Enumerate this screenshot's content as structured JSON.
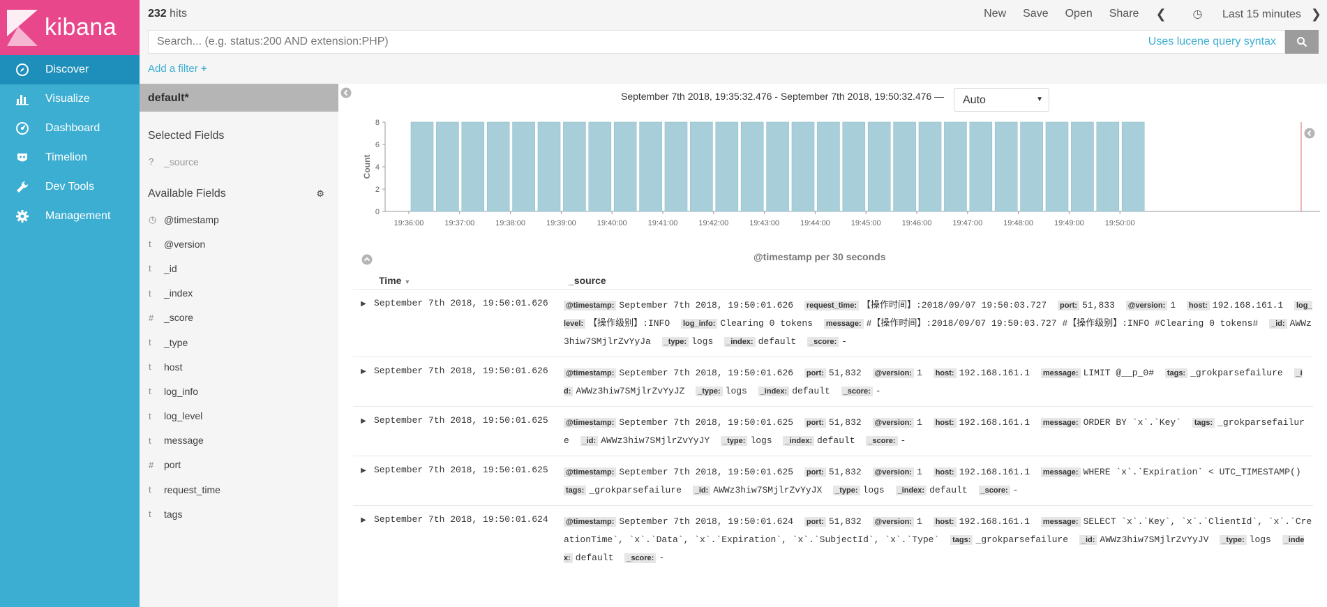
{
  "app": {
    "name": "kibana"
  },
  "nav": [
    {
      "label": "Discover",
      "icon": "compass-icon",
      "active": true
    },
    {
      "label": "Visualize",
      "icon": "bar-chart-icon",
      "active": false
    },
    {
      "label": "Dashboard",
      "icon": "dashboard-icon",
      "active": false
    },
    {
      "label": "Timelion",
      "icon": "timelion-icon",
      "active": false
    },
    {
      "label": "Dev Tools",
      "icon": "wrench-icon",
      "active": false
    },
    {
      "label": "Management",
      "icon": "gear-icon",
      "active": false
    }
  ],
  "topbar": {
    "hits_count": "232",
    "hits_label": "hits",
    "new": "New",
    "save": "Save",
    "open": "Open",
    "share": "Share",
    "time_range": "Last 15 minutes"
  },
  "search": {
    "placeholder": "Search... (e.g. status:200 AND extension:PHP)",
    "syntax_hint": "Uses lucene query syntax"
  },
  "filter": {
    "add_label": "Add a filter"
  },
  "side": {
    "index_pattern": "default*",
    "selected_title": "Selected Fields",
    "selected": [
      {
        "type": "?",
        "name": "_source"
      }
    ],
    "available_title": "Available Fields",
    "fields": [
      {
        "type": "clock",
        "name": "@timestamp"
      },
      {
        "type": "t",
        "name": "@version"
      },
      {
        "type": "t",
        "name": "_id"
      },
      {
        "type": "t",
        "name": "_index"
      },
      {
        "type": "#",
        "name": "_score"
      },
      {
        "type": "t",
        "name": "_type"
      },
      {
        "type": "t",
        "name": "host"
      },
      {
        "type": "t",
        "name": "log_info"
      },
      {
        "type": "t",
        "name": "log_level"
      },
      {
        "type": "t",
        "name": "message"
      },
      {
        "type": "#",
        "name": "port"
      },
      {
        "type": "t",
        "name": "request_time"
      },
      {
        "type": "t",
        "name": "tags"
      }
    ]
  },
  "main": {
    "date_range": "September 7th 2018, 19:35:32.476 - September 7th 2018, 19:50:32.476 —",
    "interval": "Auto"
  },
  "chart_data": {
    "type": "bar",
    "ylabel": "Count",
    "xlabel": "@timestamp per 30 seconds",
    "ylim": [
      0,
      8
    ],
    "yticks": [
      0,
      2,
      4,
      6,
      8
    ],
    "xticks": [
      "19:36:00",
      "19:37:00",
      "19:38:00",
      "19:39:00",
      "19:40:00",
      "19:41:00",
      "19:42:00",
      "19:43:00",
      "19:44:00",
      "19:45:00",
      "19:46:00",
      "19:47:00",
      "19:48:00",
      "19:49:00",
      "19:50:00"
    ],
    "bar_count": 29,
    "values": [
      8,
      8,
      8,
      8,
      8,
      8,
      8,
      8,
      8,
      8,
      8,
      8,
      8,
      8,
      8,
      8,
      8,
      8,
      8,
      8,
      8,
      8,
      8,
      8,
      8,
      8,
      8,
      8,
      8
    ],
    "color": "#a8cfd9"
  },
  "table": {
    "col_time": "Time",
    "col_source": "_source",
    "rows": [
      {
        "time": "September 7th 2018, 19:50:01.626",
        "fields": [
          [
            "@timestamp:",
            "September 7th 2018, 19:50:01.626"
          ],
          [
            "request_time:",
            "【操作时间】:2018/09/07 19:50:03.727"
          ],
          [
            "port:",
            "51,833"
          ],
          [
            "@version:",
            "1"
          ],
          [
            "host:",
            "192.168.161.1"
          ],
          [
            "log_level:",
            "【操作级别】:INFO"
          ],
          [
            "log_info:",
            "Clearing 0 tokens"
          ],
          [
            "message:",
            "#【操作时间】:2018/09/07 19:50:03.727 #【操作级别】:INFO #Clearing 0 tokens#"
          ],
          [
            "_id:",
            "AWWz3hiw7SMjlrZvYyJa"
          ],
          [
            "_type:",
            "logs"
          ],
          [
            "_index:",
            "default"
          ],
          [
            "_score:",
            "-"
          ]
        ]
      },
      {
        "time": "September 7th 2018, 19:50:01.626",
        "fields": [
          [
            "@timestamp:",
            "September 7th 2018, 19:50:01.626"
          ],
          [
            "port:",
            "51,832"
          ],
          [
            "@version:",
            "1"
          ],
          [
            "host:",
            "192.168.161.1"
          ],
          [
            "message:",
            "LIMIT @__p_0#"
          ],
          [
            "tags:",
            "_grokparsefailure"
          ],
          [
            "_id:",
            "AWWz3hiw7SMjlrZvYyJZ"
          ],
          [
            "_type:",
            "logs"
          ],
          [
            "_index:",
            "default"
          ],
          [
            "_score:",
            "-"
          ]
        ]
      },
      {
        "time": "September 7th 2018, 19:50:01.625",
        "fields": [
          [
            "@timestamp:",
            "September 7th 2018, 19:50:01.625"
          ],
          [
            "port:",
            "51,832"
          ],
          [
            "@version:",
            "1"
          ],
          [
            "host:",
            "192.168.161.1"
          ],
          [
            "message:",
            "ORDER BY `x`.`Key`"
          ],
          [
            "tags:",
            "_grokparsefailure"
          ],
          [
            "_id:",
            "AWWz3hiw7SMjlrZvYyJY"
          ],
          [
            "_type:",
            "logs"
          ],
          [
            "_index:",
            "default"
          ],
          [
            "_score:",
            "-"
          ]
        ]
      },
      {
        "time": "September 7th 2018, 19:50:01.625",
        "fields": [
          [
            "@timestamp:",
            "September 7th 2018, 19:50:01.625"
          ],
          [
            "port:",
            "51,832"
          ],
          [
            "@version:",
            "1"
          ],
          [
            "host:",
            "192.168.161.1"
          ],
          [
            "message:",
            "WHERE `x`.`Expiration` < UTC_TIMESTAMP()"
          ],
          [
            "tags:",
            "_grokparsefailure"
          ],
          [
            "_id:",
            "AWWz3hiw7SMjlrZvYyJX"
          ],
          [
            "_type:",
            "logs"
          ],
          [
            "_index:",
            "default"
          ],
          [
            "_score:",
            "-"
          ]
        ]
      },
      {
        "time": "September 7th 2018, 19:50:01.624",
        "fields": [
          [
            "@timestamp:",
            "September 7th 2018, 19:50:01.624"
          ],
          [
            "port:",
            "51,832"
          ],
          [
            "@version:",
            "1"
          ],
          [
            "host:",
            "192.168.161.1"
          ],
          [
            "message:",
            "SELECT `x`.`Key`, `x`.`ClientId`, `x`.`CreationTime`, `x`.`Data`, `x`.`Expiration`, `x`.`SubjectId`, `x`.`Type`"
          ],
          [
            "tags:",
            "_grokparsefailure"
          ],
          [
            "_id:",
            "AWWz3hiw7SMjlrZvYyJV"
          ],
          [
            "_type:",
            "logs"
          ],
          [
            "_index:",
            "default"
          ],
          [
            "_score:",
            "-"
          ]
        ]
      }
    ]
  }
}
